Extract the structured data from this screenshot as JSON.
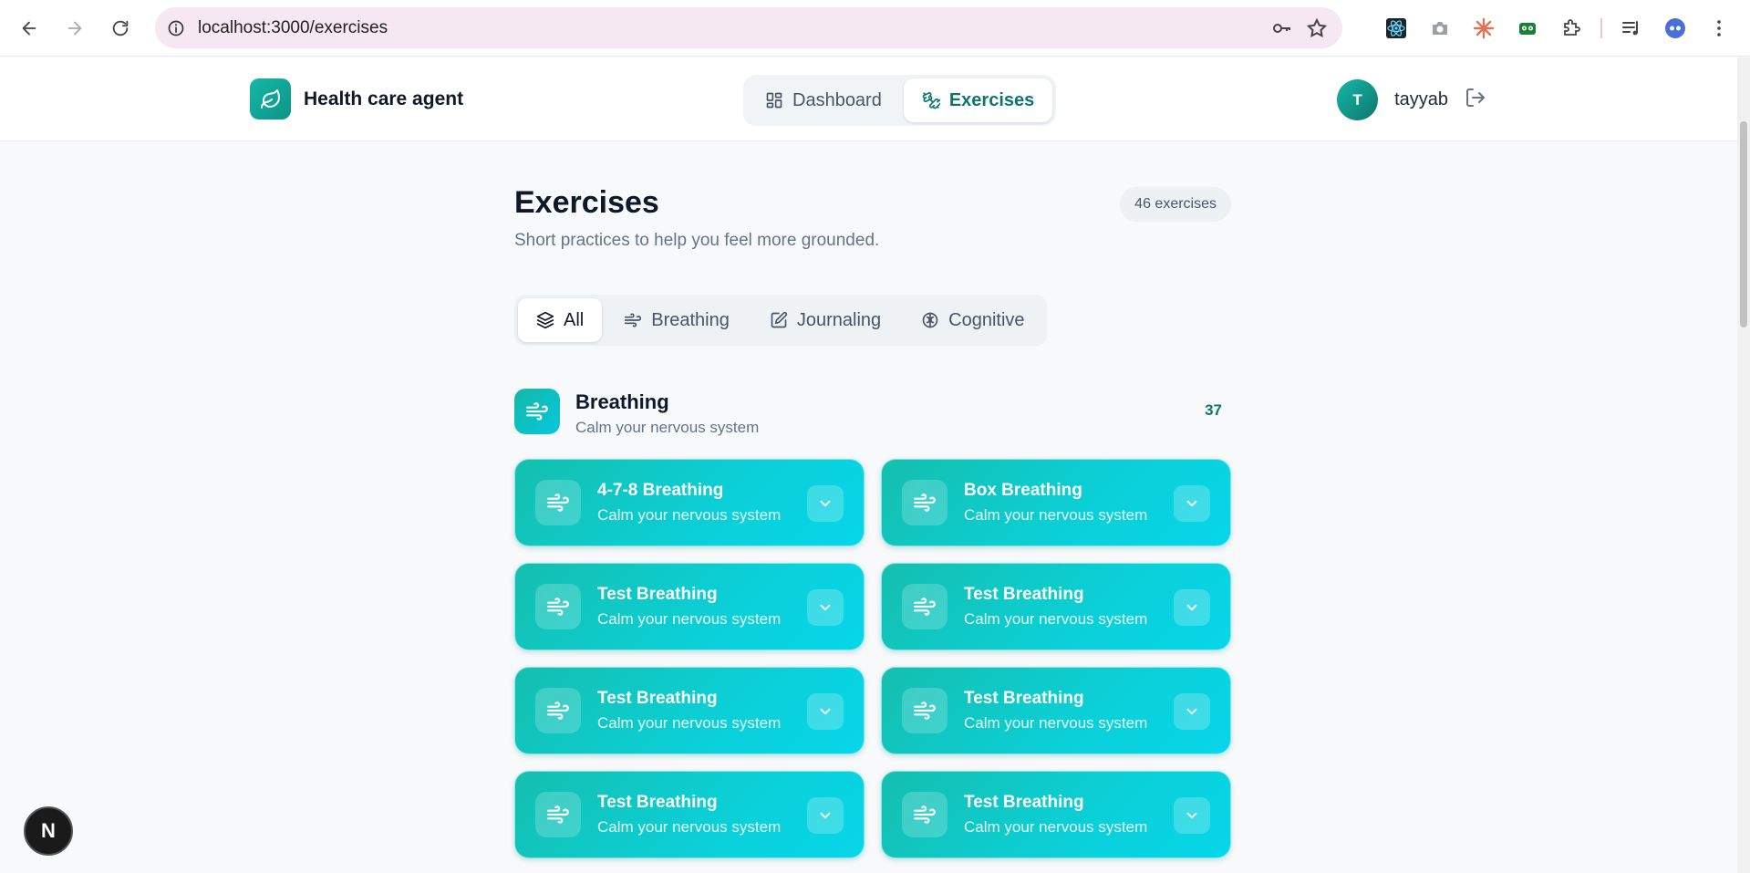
{
  "browser": {
    "url": "localhost:3000/exercises"
  },
  "app": {
    "brand_name": "Health care agent",
    "nav": [
      {
        "label": "Dashboard",
        "icon": "dashboard-icon",
        "active": false
      },
      {
        "label": "Exercises",
        "icon": "exercises-icon",
        "active": true
      }
    ],
    "user": {
      "initial": "T",
      "name": "tayyab"
    }
  },
  "page": {
    "title": "Exercises",
    "subtitle": "Short practices to help you feel more grounded.",
    "count_label": "46 exercises",
    "filters": [
      {
        "label": "All",
        "icon": "layers-icon",
        "active": true
      },
      {
        "label": "Breathing",
        "icon": "wind-icon",
        "active": false
      },
      {
        "label": "Journaling",
        "icon": "edit-icon",
        "active": false
      },
      {
        "label": "Cognitive",
        "icon": "brain-icon",
        "active": false
      }
    ]
  },
  "section": {
    "title": "Breathing",
    "subtitle": "Calm your nervous system",
    "count": "37",
    "cards": [
      {
        "title": "4-7-8 Breathing",
        "subtitle": "Calm your nervous system"
      },
      {
        "title": "Box Breathing",
        "subtitle": "Calm your nervous system"
      },
      {
        "title": "Test Breathing",
        "subtitle": "Calm your nervous system"
      },
      {
        "title": "Test Breathing",
        "subtitle": "Calm your nervous system"
      },
      {
        "title": "Test Breathing",
        "subtitle": "Calm your nervous system"
      },
      {
        "title": "Test Breathing",
        "subtitle": "Calm your nervous system"
      },
      {
        "title": "Test Breathing",
        "subtitle": "Calm your nervous system"
      },
      {
        "title": "Test Breathing",
        "subtitle": "Calm your nervous system"
      }
    ]
  },
  "dev_badge": {
    "letter": "N"
  },
  "colors": {
    "accent": "#0f766e",
    "card_gradient_start": "#14bfae",
    "card_gradient_end": "#06d6ea"
  }
}
